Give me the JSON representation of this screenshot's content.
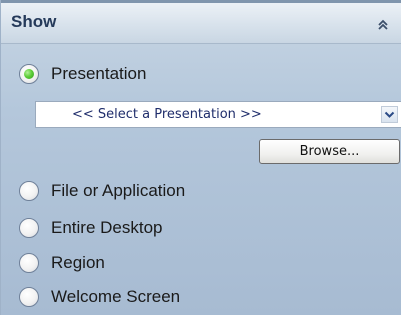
{
  "header": {
    "title": "Show",
    "collapse_icon": "double-chevron-up-icon"
  },
  "options": [
    {
      "label": "Presentation",
      "selected": true
    },
    {
      "label": "File or Application",
      "selected": false
    },
    {
      "label": "Entire Desktop",
      "selected": false
    },
    {
      "label": "Region",
      "selected": false
    },
    {
      "label": "Welcome Screen",
      "selected": false
    }
  ],
  "presentation_select": {
    "value": "<< Select a Presentation >>",
    "arrow_icon": "chevron-down-icon"
  },
  "browse_button": {
    "label": "Browse..."
  },
  "colors": {
    "panel": "#b4c7db",
    "header": "#d8e2ec",
    "title_text": "#253a5a",
    "radio_selected": "#5fcf3a"
  }
}
